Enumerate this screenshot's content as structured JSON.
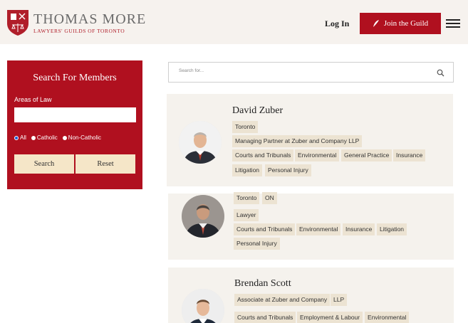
{
  "header": {
    "logo_title": "THOMAS MORE",
    "logo_subtitle": "LAWYERS' GUILDS OF TORONTO",
    "login_label": "Log In",
    "join_label": "Join the Guild"
  },
  "sidebar": {
    "title": "Search For Members",
    "areas_label": "Areas of Law",
    "areas_value": "",
    "radio_options": [
      "All",
      "Catholic",
      "Non-Catholic"
    ],
    "selected_option": "All",
    "search_button": "Search",
    "reset_button": "Reset"
  },
  "search": {
    "placeholder": "Search for..."
  },
  "members": [
    {
      "name": "David Zuber",
      "tags_line1": [
        "Toronto"
      ],
      "tags_line2": [
        "Managing Partner at Zuber and Company LLP"
      ],
      "tags_line3": [
        "Courts and Tribunals",
        "Environmental",
        "General Practice",
        "Insurance"
      ],
      "tags_line4": [
        "Litigation",
        "Personal Injury"
      ]
    },
    {
      "name": "",
      "tags_line1": [
        "Toronto",
        "ON"
      ],
      "tags_line2": [
        "Lawyer"
      ],
      "tags_line3": [
        "Courts and Tribunals",
        "Environmental",
        "Insurance",
        "Litigation"
      ],
      "tags_line4": [
        "Personal Injury"
      ]
    },
    {
      "name": "Brendan Scott",
      "tags_line1": [
        "Associate at Zuber and Company",
        "LLP"
      ],
      "tags_line2": [],
      "tags_line3": [
        "Courts and Tribunals",
        "Employment & Labour",
        "Environmental"
      ],
      "tags_line4": []
    }
  ],
  "colors": {
    "brand_red": "#b0101f",
    "button_cream": "#f5e6c8",
    "tag_bg": "#ece3d2",
    "card_bg": "#f5f2ed"
  }
}
